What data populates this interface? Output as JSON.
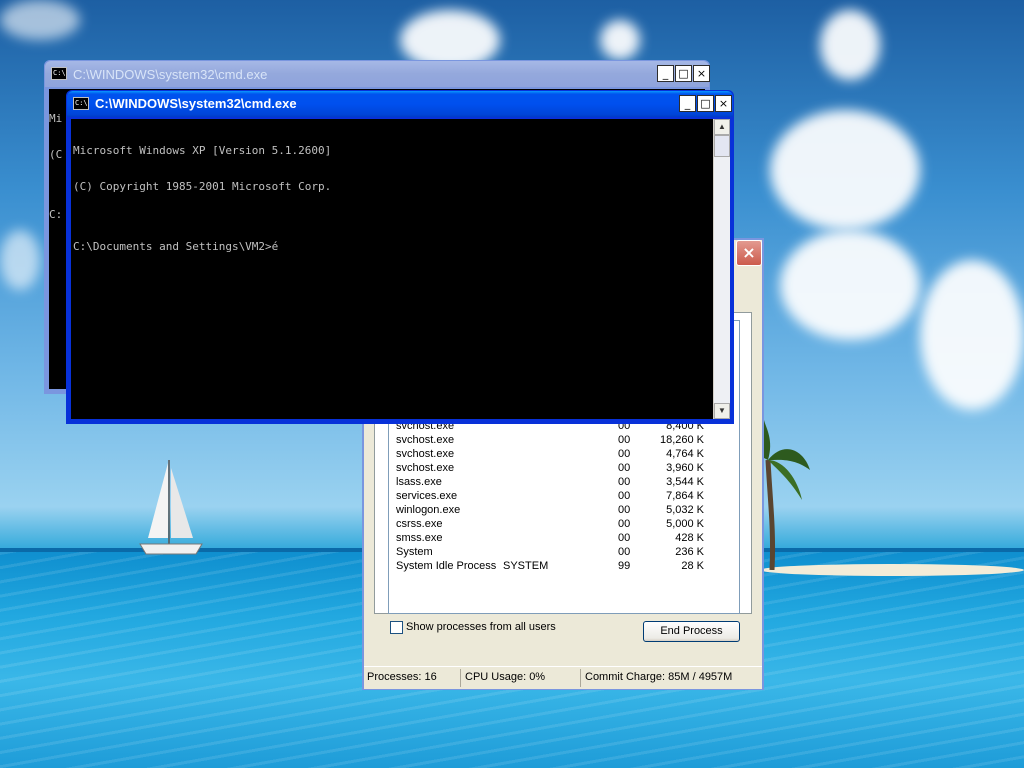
{
  "back_window": {
    "title": "C:\\WINDOWS\\system32\\cmd.exe",
    "console_peek": [
      "Mi",
      "(C",
      "",
      "C:"
    ]
  },
  "front_window": {
    "title": "C:\\WINDOWS\\system32\\cmd.exe",
    "console_lines": [
      "Microsoft Windows XP [Version 5.1.2600]",
      "(C) Copyright 1985-2001 Microsoft Corp.",
      "",
      "C:\\Documents and Settings\\VM2>é"
    ]
  },
  "title_buttons": {
    "minimize": "_",
    "maximize": "□",
    "close": "×"
  },
  "task_manager": {
    "close": "×",
    "processes": [
      {
        "name": "svchost.exe",
        "user": "",
        "cpu": "00",
        "mem": "8,400 K"
      },
      {
        "name": "svchost.exe",
        "user": "",
        "cpu": "00",
        "mem": "18,260 K"
      },
      {
        "name": "svchost.exe",
        "user": "",
        "cpu": "00",
        "mem": "4,764 K"
      },
      {
        "name": "svchost.exe",
        "user": "",
        "cpu": "00",
        "mem": "3,960 K"
      },
      {
        "name": "lsass.exe",
        "user": "",
        "cpu": "00",
        "mem": "3,544 K"
      },
      {
        "name": "services.exe",
        "user": "",
        "cpu": "00",
        "mem": "7,864 K"
      },
      {
        "name": "winlogon.exe",
        "user": "",
        "cpu": "00",
        "mem": "5,032 K"
      },
      {
        "name": "csrss.exe",
        "user": "",
        "cpu": "00",
        "mem": "5,000 K"
      },
      {
        "name": "smss.exe",
        "user": "",
        "cpu": "00",
        "mem": "428 K"
      },
      {
        "name": "System",
        "user": "",
        "cpu": "00",
        "mem": "236 K"
      },
      {
        "name": "System Idle Process",
        "user": "SYSTEM",
        "cpu": "99",
        "mem": "28 K"
      }
    ],
    "show_all_label": "Show processes from all users",
    "end_process_label": "End Process",
    "status": {
      "processes": "Processes: 16",
      "cpu": "CPU Usage: 0%",
      "commit": "Commit Charge: 85M / 4957M"
    }
  },
  "colors": {
    "title_active": "#0053ee",
    "title_inactive": "#94a8dc",
    "console_bg": "#000000",
    "console_fg": "#c0c0c0"
  }
}
